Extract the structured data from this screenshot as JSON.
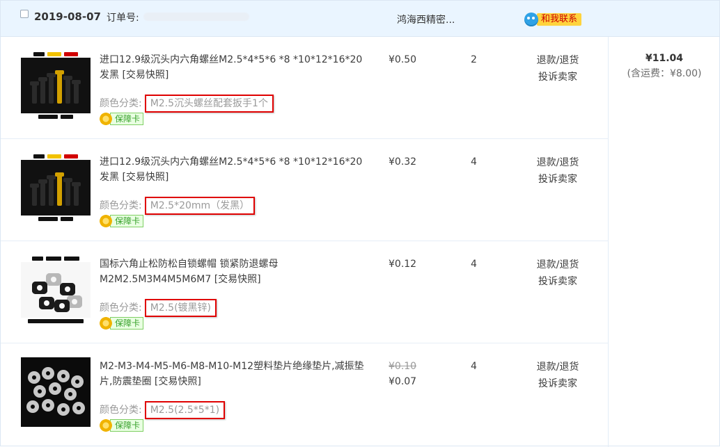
{
  "header": {
    "date": "2019-08-07",
    "order_label": "订单号:",
    "seller_name": "鸿海西精密...",
    "contact_label": "和我联系"
  },
  "items": [
    {
      "title": "进口12.9级沉头内六角螺丝M2.5*4*5*6 *8 *10*12*16*20 发黑",
      "snapshot_label": "[交易快照]",
      "sku_label": "颜色分类:",
      "sku_value": "M2.5沉头螺丝配套扳手1个",
      "badge_label": "保障卡",
      "price": "¥0.50",
      "original_price": "",
      "quantity": "2",
      "action_refund": "退款/退货",
      "action_complain": "投诉卖家",
      "thumbnail": "hex-screws-thumbnail"
    },
    {
      "title": "进口12.9级沉头内六角螺丝M2.5*4*5*6 *8 *10*12*16*20 发黑",
      "snapshot_label": "[交易快照]",
      "sku_label": "颜色分类:",
      "sku_value": "M2.5*20mm（发黑）",
      "badge_label": "保障卡",
      "price": "¥0.32",
      "original_price": "",
      "quantity": "4",
      "action_refund": "退款/退货",
      "action_complain": "投诉卖家",
      "thumbnail": "hex-screws-thumbnail"
    },
    {
      "title": "国标六角止松防松自锁螺帽 锁紧防退螺母M2M2.5M3M4M5M6M7",
      "snapshot_label": "[交易快照]",
      "sku_label": "颜色分类:",
      "sku_value": "M2.5(镀黑锌)",
      "badge_label": "保障卡",
      "price": "¥0.12",
      "original_price": "",
      "quantity": "4",
      "action_refund": "退款/退货",
      "action_complain": "投诉卖家",
      "thumbnail": "lock-nuts-thumbnail"
    },
    {
      "title": "M2-M3-M4-M5-M6-M8-M10-M12塑料垫片绝缘垫片,减振垫片,防震垫圈",
      "snapshot_label": "[交易快照]",
      "sku_label": "颜色分类:",
      "sku_value": "M2.5(2.5*5*1)",
      "badge_label": "保障卡",
      "price": "¥0.07",
      "original_price": "¥0.10",
      "quantity": "4",
      "action_refund": "退款/退货",
      "action_complain": "投诉卖家",
      "thumbnail": "plastic-washers-thumbnail"
    }
  ],
  "total": {
    "amount": "¥11.04",
    "shipping": "(含运费：¥8.00)"
  },
  "colors": {
    "header_bg": "#eaf5ff",
    "highlight_border": "#e00000",
    "badge_green": "#39a12c",
    "contact_bg": "#ffd33d"
  },
  "icons": {
    "checkbox": "checkbox-icon",
    "contact": "wangwang-chat-icon",
    "badge": "guarantee-flower-icon"
  }
}
